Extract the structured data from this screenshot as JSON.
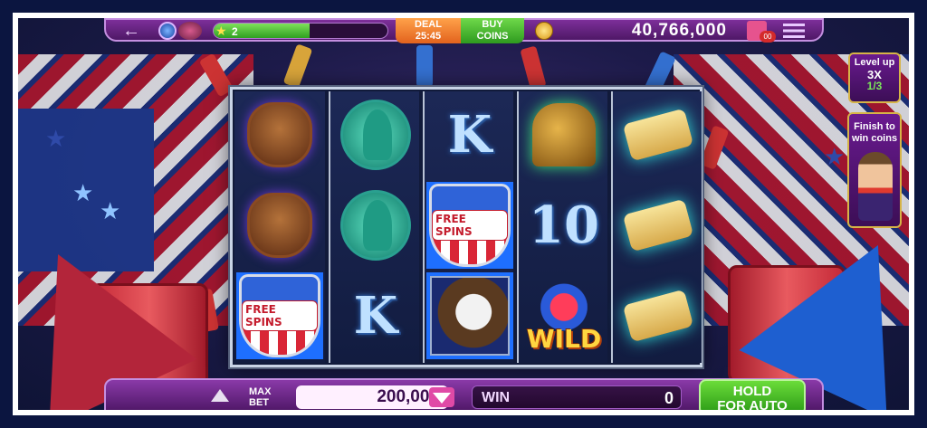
{
  "topbar": {
    "level": "2",
    "level_progress": 0.55,
    "deal_label": "DEAL",
    "deal_timer": "25:45",
    "buy_label_1": "BUY",
    "buy_label_2": "COINS",
    "coins": "40,766,000",
    "gift_badge": "00"
  },
  "reels": [
    [
      "bison",
      "bison",
      "free-spins"
    ],
    [
      "liberty",
      "liberty",
      "K"
    ],
    [
      "K",
      "free-spins",
      "eagle"
    ],
    [
      "bell",
      "10",
      "wild"
    ],
    [
      "scroll",
      "scroll",
      "scroll"
    ]
  ],
  "symbols": {
    "letter_k": "K",
    "number_10": "10",
    "free_spins": "FREE SPINS",
    "wild": "WILD"
  },
  "side": {
    "level_up_1": "Level up",
    "level_up_2": "3X",
    "level_up_3": "1/3",
    "finish_1": "Finish to",
    "finish_2": "win coins"
  },
  "bottombar": {
    "max_bet_1": "MAX",
    "max_bet_2": "BET",
    "bet": "200,000",
    "win_label": "WIN",
    "win": "0",
    "hold_1": "HOLD",
    "hold_2": "FOR AUTO"
  },
  "colors": {
    "accent_purple": "#7d2f9a",
    "buy_green": "#2e9a1f",
    "deal_orange": "#e2621d",
    "gold": "#d6b447"
  }
}
